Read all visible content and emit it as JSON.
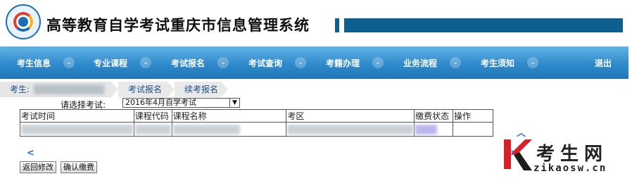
{
  "header": {
    "title": "高等教育自学考试重庆市信息管理系统"
  },
  "nav": {
    "items": [
      {
        "label": "考生信息"
      },
      {
        "label": "专业课程"
      },
      {
        "label": "考试报名"
      },
      {
        "label": "考试查询"
      },
      {
        "label": "考籍办理"
      },
      {
        "label": "业务流程"
      },
      {
        "label": "考生须知"
      }
    ],
    "logout": "退出",
    "dot_icon": "chevron-down-icon"
  },
  "breadcrumb": {
    "user_prefix": "考生: ",
    "items": [
      "考试报名",
      "续考报名"
    ]
  },
  "exam_select": {
    "label": "请选择考试:",
    "value": "2016年4月自学考试"
  },
  "table": {
    "columns": [
      "考试时间",
      "课程代码",
      "课程名称",
      "考区",
      "缴费状态",
      "操作"
    ]
  },
  "buttons": {
    "back": "返回修改",
    "confirm": "确认缴费"
  },
  "watermark": {
    "title": "考生网",
    "url": "zikaosw.cn"
  },
  "colors": {
    "nav_blue": "#2f8acb",
    "header_bar": "#0f5f8e",
    "watermark_red": "#d6202a"
  }
}
